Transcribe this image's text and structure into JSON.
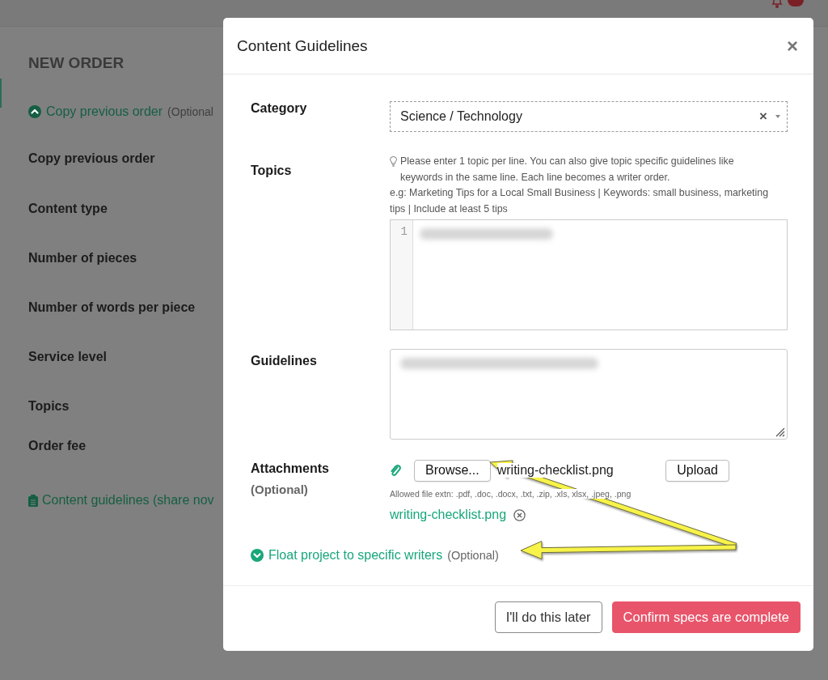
{
  "background": {
    "heading": "NEW ORDER",
    "toggle": {
      "label": "Copy previous order",
      "note": "(Optional",
      "expanded": true
    },
    "fields": [
      "Copy previous order",
      "Content type",
      "Number of pieces",
      "Number of words per piece",
      "Service level",
      "Topics",
      "Order fee"
    ],
    "guidelines_link": "Content guidelines (share nov"
  },
  "modal": {
    "title": "Content Guidelines",
    "close": "×",
    "category": {
      "label": "Category",
      "value": "Science / Technology",
      "clear": "×"
    },
    "topics": {
      "label": "Topics",
      "hint_lines": [
        "Please enter 1 topic per line. You can also give topic specific guidelines like keywords in the same line. Each line becomes a writer order.",
        "e.g: Marketing Tips for a Local Small Business | Keywords: small business, marketing tips | Include at least 5 tips"
      ],
      "line_numbers": [
        "1"
      ]
    },
    "guidelines": {
      "label": "Guidelines"
    },
    "attachments": {
      "label": "Attachments",
      "note": "(Optional)",
      "browse": "Browse...",
      "file_name": "writing-checklist.png",
      "upload": "Upload",
      "allowed": "Allowed file extn: .pdf, .doc, .docx, .txt, .zip, .xls, xlsx, .jpeg, .png",
      "files": [
        {
          "name": "writing-checklist.png"
        }
      ]
    },
    "float_toggle": {
      "label": "Float project to specific writers",
      "note": "(Optional)",
      "expanded": false
    },
    "buttons": [
      {
        "label": "I'll do this later",
        "kind": "secondary"
      },
      {
        "label": "Confirm specs are complete",
        "kind": "primary"
      }
    ]
  }
}
